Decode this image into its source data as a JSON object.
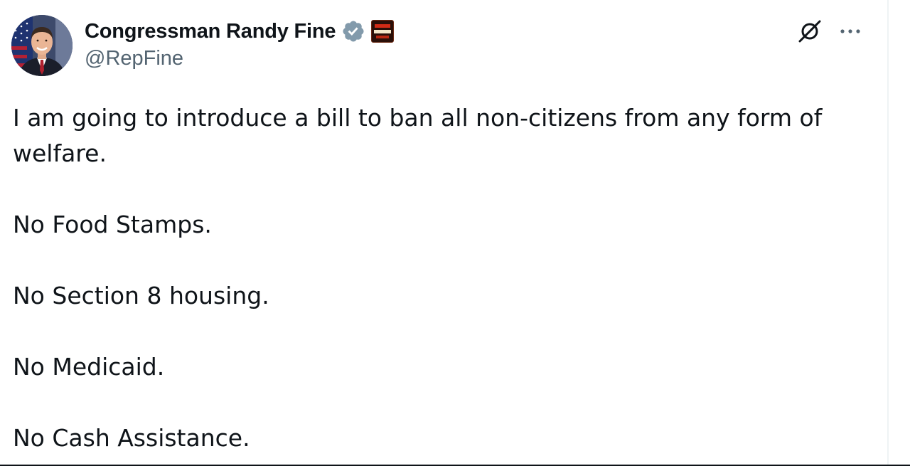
{
  "author": {
    "display_name": "Congressman Randy Fine",
    "handle": "@RepFine",
    "verified_icon": "verified-badge-icon",
    "affiliate_badge_icon": "house-gop-affiliate-badge-icon",
    "avatar_icon": "profile-avatar"
  },
  "actions": {
    "grok_icon": "grok-icon",
    "more_icon": "more-options-icon"
  },
  "tweet": {
    "paragraphs": [
      "I am going to introduce a bill to ban all non-citizens from any form of welfare.",
      "No Food Stamps.",
      "No Section 8 housing.",
      "No Medicaid.",
      "No Cash Assistance."
    ]
  },
  "colors": {
    "text_primary": "#0f1419",
    "text_secondary": "#536471",
    "verified_gray": "#829aab",
    "border": "#eff3f4"
  }
}
